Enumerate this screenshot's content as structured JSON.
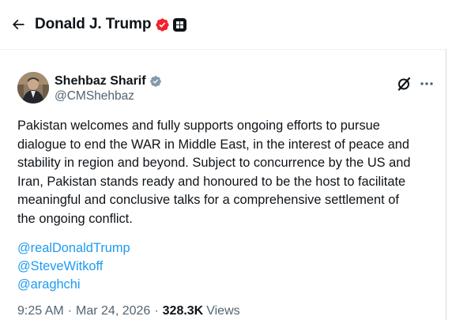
{
  "header": {
    "back_icon": "arrow-left-icon",
    "title": "Donald J. Trump",
    "badge_icon": "verified-badge-icon",
    "badge_color": "#f4212e",
    "affiliate_icon": "affiliate-square-icon"
  },
  "post": {
    "author": {
      "name": "Shehbaz Sharif",
      "handle": "@CMShehbaz",
      "verified_icon": "verified-badge-icon",
      "verified_color": "#829aab"
    },
    "actions": {
      "grok_icon": "grok-icon",
      "more_icon": "more-icon"
    },
    "text": "Pakistan welcomes and fully supports ongoing efforts to pursue\ndialogue to end the WAR in Middle East, in the interest of peace and\nstability in region and beyond. Subject to concurrence by the US and\nIran, Pakistan stands ready and honoured to be the host to facilitate\nmeaningful and conclusive talks for a comprehensive settlement of\nthe ongoing conflict.",
    "mentions": [
      "@realDonaldTrump",
      "@SteveWitkoff",
      "@araghchi"
    ],
    "meta": {
      "time": "9:25 AM",
      "separator": "·",
      "date": "Mar 24, 2026",
      "views_count": "328.3K",
      "views_label": "Views"
    }
  },
  "colors": {
    "link": "#1d9bf0",
    "text": "#0f1419",
    "secondary": "#536471"
  }
}
